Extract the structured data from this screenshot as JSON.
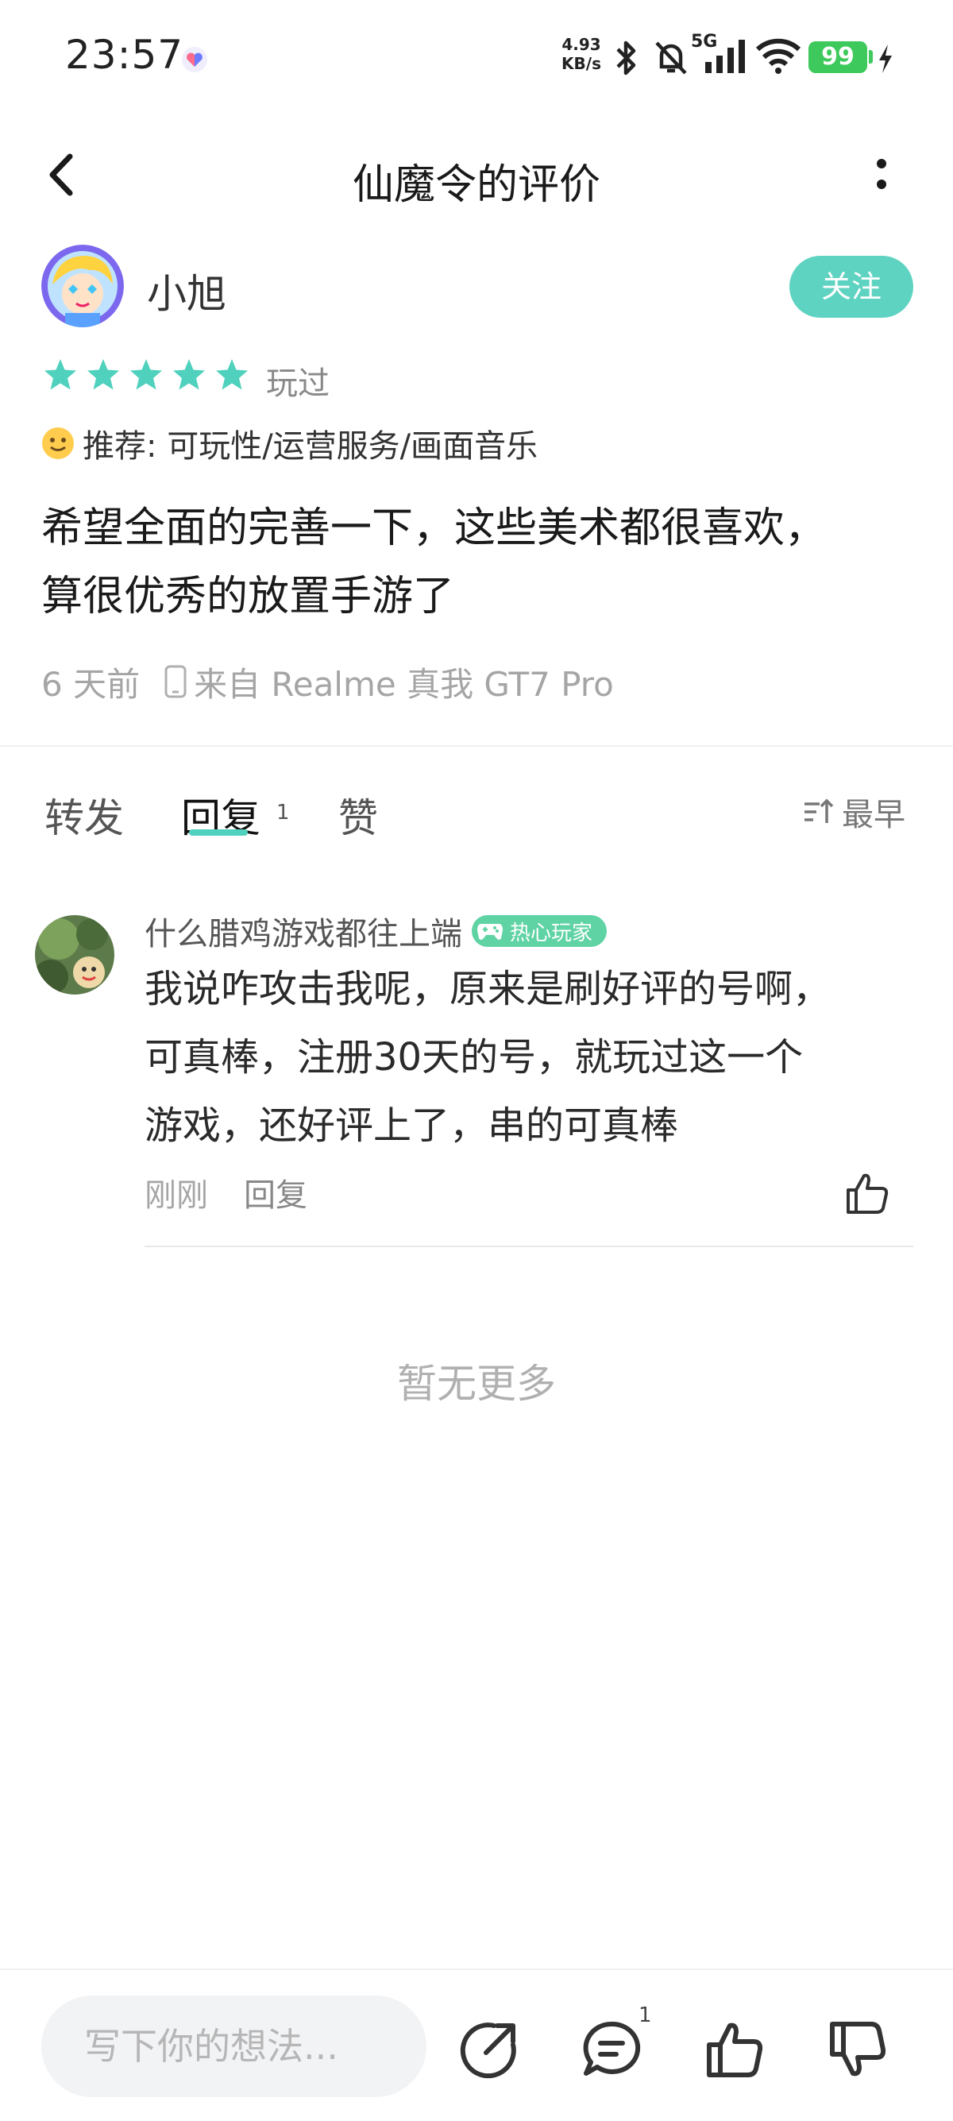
{
  "status_bar": {
    "time": "23:57",
    "net_speed_value": "4.93",
    "net_speed_unit": "KB/s",
    "network": "5G",
    "battery": "99"
  },
  "header": {
    "title": "仙魔令的评价"
  },
  "author": {
    "name": "小旭",
    "follow_label": "关注"
  },
  "rating": {
    "stars": 5,
    "played_label": "玩过",
    "star_color": "#4fd1bd"
  },
  "recommend": {
    "text": "推荐: 可玩性/运营服务/画面音乐"
  },
  "review": {
    "line1": "希望全面的完善一下，这些美术都很喜欢，",
    "line2": "算很优秀的放置手游了"
  },
  "meta": {
    "time_ago": "6 天前",
    "device": "来自 Realme 真我 GT7 Pro"
  },
  "tabs": {
    "forward": "转发",
    "reply": "回复",
    "reply_count": "1",
    "like": "赞",
    "sort": "最早"
  },
  "comment": {
    "user": "什么腊鸡游戏都往上端",
    "badge": "热心玩家",
    "line1": "我说咋攻击我呢，原来是刷好评的号啊，",
    "line2": "可真棒，注册30天的号，就玩过这一个",
    "line3": "游戏，还好评上了，串的可真棒",
    "time": "刚刚",
    "reply_label": "回复"
  },
  "no_more": "暂无更多",
  "bottom_bar": {
    "input_placeholder": "写下你的想法...",
    "comment_count": "1"
  },
  "colors": {
    "accent": "#5fd3c1",
    "battery": "#3dc95b",
    "badge": "#5fd3a4"
  }
}
